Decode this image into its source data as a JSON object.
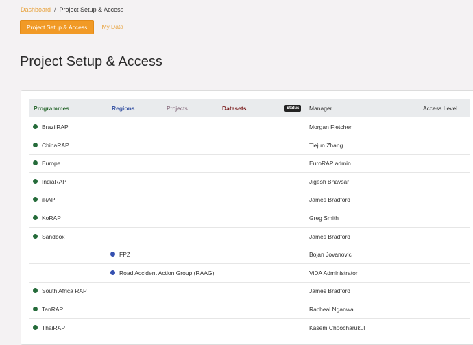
{
  "breadcrumb": {
    "home": "Dashboard",
    "separator": "/",
    "current": "Project Setup & Access"
  },
  "tabs": {
    "active": "Project Setup & Access",
    "other": "My Data"
  },
  "page_title": "Project Setup & Access",
  "table": {
    "headers": {
      "programmes": "Programmes",
      "regions": "Regions",
      "projects": "Projects",
      "datasets": "Datasets",
      "status": "Status",
      "manager": "Manager",
      "access_level": "Access Level"
    },
    "rows": [
      {
        "name": "BrazilRAP",
        "level": "programme",
        "dot_color": "#256b3a",
        "manager": "Morgan Fletcher"
      },
      {
        "name": "ChinaRAP",
        "level": "programme",
        "dot_color": "#256b3a",
        "manager": "Tiejun Zhang"
      },
      {
        "name": "Europe",
        "level": "programme",
        "dot_color": "#256b3a",
        "manager": "EuroRAP admin"
      },
      {
        "name": "IndiaRAP",
        "level": "programme",
        "dot_color": "#256b3a",
        "manager": "Jigesh Bhavsar"
      },
      {
        "name": "iRAP",
        "level": "programme",
        "dot_color": "#256b3a",
        "manager": "James Bradford"
      },
      {
        "name": "KoRAP",
        "level": "programme",
        "dot_color": "#256b3a",
        "manager": "Greg Smith"
      },
      {
        "name": "Sandbox",
        "level": "programme",
        "dot_color": "#256b3a",
        "manager": "James Bradford"
      },
      {
        "name": "FPZ",
        "level": "region",
        "dot_color": "#3550b0",
        "manager": "Bojan Jovanovic"
      },
      {
        "name": "Road Accident Action Group (RAAG)",
        "level": "region",
        "dot_color": "#3550b0",
        "manager": "ViDA Administrator"
      },
      {
        "name": "South Africa RAP",
        "level": "programme",
        "dot_color": "#256b3a",
        "manager": "James Bradford"
      },
      {
        "name": "TanRAP",
        "level": "programme",
        "dot_color": "#256b3a",
        "manager": "Racheal Nganwa"
      },
      {
        "name": "ThaiRAP",
        "level": "programme",
        "dot_color": "#256b3a",
        "manager": "Kasem Choocharukul"
      }
    ]
  }
}
